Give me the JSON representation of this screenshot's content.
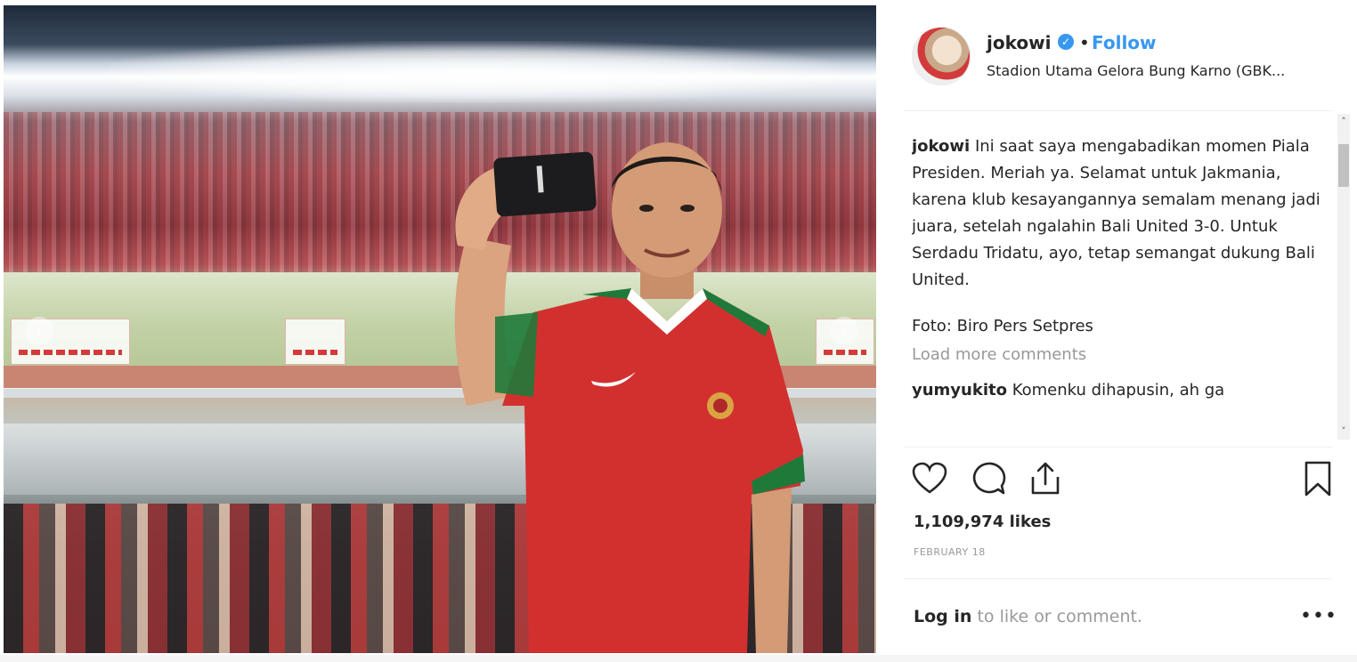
{
  "post": {
    "photo": {
      "prev_arrow": "‹",
      "next_arrow": "›"
    },
    "header": {
      "username": "jokowi",
      "verified_icon": "✓",
      "separator": "•",
      "follow_label": "Follow",
      "location": "Stadion Utama Gelora Bung Karno (GBK..."
    },
    "caption": {
      "username": "jokowi",
      "text": "Ini saat saya mengabadikan momen Piala Presiden. Meriah ya. Selamat untuk Jakmania, karena klub kesayangannya semalam menang jadi juara, setelah ngalahin Bali United 3-0. Untuk Serdadu Tridatu, ayo, tetap semangat dukung Bali United.",
      "credit": "Foto: Biro Pers Setpres"
    },
    "load_more_comments": "Load more comments",
    "comments": [
      {
        "username": "yumyukito",
        "text": "Komenku dihapusin, ah ga"
      }
    ],
    "scrollbar": {
      "up": "˄",
      "down": "˅"
    },
    "actions": {
      "like_icon": "heart-icon",
      "comment_icon": "comment-icon",
      "share_icon": "share-icon",
      "save_icon": "bookmark-icon"
    },
    "likes": "1,109,974 likes",
    "date": "FEBRUARY 18",
    "login": {
      "link_text": "Log in",
      "rest_text": " to like or comment."
    },
    "more_options": "•••"
  },
  "colors": {
    "accent_blue": "#3897f0",
    "text_primary": "#262626",
    "text_secondary": "#999999",
    "jersey_red": "#d2302f",
    "jersey_green": "#1f7a3a"
  }
}
